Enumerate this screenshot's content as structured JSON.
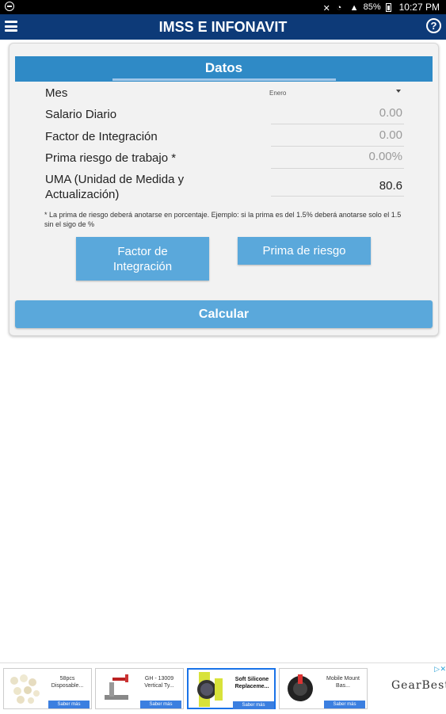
{
  "statusbar": {
    "battery": "85%",
    "time": "10:27 PM"
  },
  "appbar": {
    "title": "IMSS E INFONAVIT",
    "help": "?"
  },
  "form": {
    "header": "Datos",
    "mes": {
      "label": "Mes",
      "value": "Enero"
    },
    "salario": {
      "label": "Salario Diario",
      "placeholder": "0.00"
    },
    "factor": {
      "label": "Factor de Integración",
      "placeholder": "0.00"
    },
    "prima": {
      "label": "Prima riesgo de trabajo *",
      "placeholder": "0.00%"
    },
    "uma": {
      "label": "UMA (Unidad de Medida y Actualización)",
      "value": "80.6"
    },
    "note": "* La prima de riesgo deberá anotarse en porcentaje. Ejemplo: si la prima es del 1.5% deberá anotarse solo el 1.5 sin el sigo de %",
    "btn_factor": "Factor de Integración",
    "btn_prima": "Prima de riesgo",
    "btn_calc": "Calcular"
  },
  "ad": {
    "items": [
      {
        "text": "58pcs Disposable...",
        "button": "Saber más"
      },
      {
        "text": "GH - 13009 Vertical Ty...",
        "button": "Saber más"
      },
      {
        "text": "Soft Silicone Replaceme...",
        "button": "Saber más"
      },
      {
        "text": "Mobile Mount Bas...",
        "button": "Saber más"
      }
    ],
    "brand": "GearBest"
  }
}
